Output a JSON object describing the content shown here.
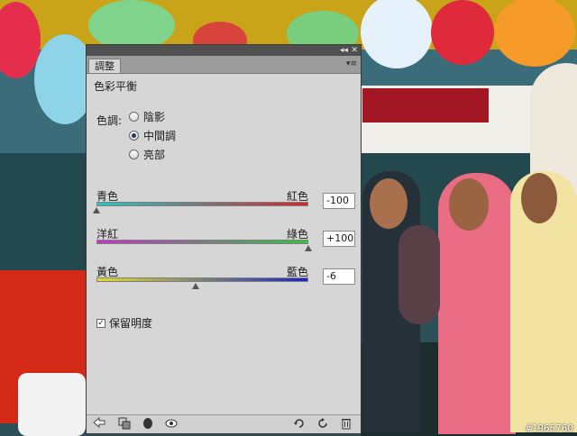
{
  "panel": {
    "tab_label": "調整",
    "title": "色彩平衡",
    "tone": {
      "label": "色調:",
      "options": [
        {
          "label": "陰影",
          "selected": false
        },
        {
          "label": "中間調",
          "selected": true
        },
        {
          "label": "亮部",
          "selected": false
        }
      ]
    },
    "sliders": [
      {
        "left_label": "青色",
        "right_label": "紅色",
        "value": "-100",
        "level": -100
      },
      {
        "left_label": "洋紅",
        "right_label": "綠色",
        "value": "+100",
        "level": 100
      },
      {
        "left_label": "黃色",
        "right_label": "藍色",
        "value": "-6",
        "level": -6
      }
    ],
    "preserve_luminosity": {
      "label": "保留明度",
      "checked": true
    },
    "controls": {
      "collapse": "◂◂",
      "close": "✕",
      "menu": "▾≡"
    }
  },
  "bottom_icons": [
    "back-arrow-icon",
    "clip-to-layer-icon",
    "mask-icon",
    "visibility-eye-icon",
    "reset-icon",
    "refresh-icon",
    "trash-icon"
  ],
  "watermark": "#1965760"
}
